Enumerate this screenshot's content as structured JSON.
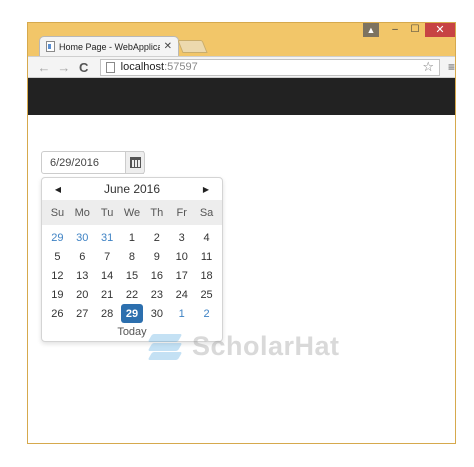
{
  "window": {
    "controls": {
      "user": "▲",
      "minimize": "–",
      "maximize": "☐",
      "close": "✕"
    }
  },
  "tab": {
    "title": "Home Page - WebApplica",
    "close": "✕"
  },
  "toolbar": {
    "back": "←",
    "forward": "→",
    "reload": "C",
    "url_host": "localhost",
    "url_port": ":57597",
    "star": "☆",
    "menu": "≡"
  },
  "date_input": {
    "value": "6/29/2016"
  },
  "datepicker": {
    "prev": "◀",
    "next": "▶",
    "month_label": "June 2016",
    "weekdays": [
      "Su",
      "Mo",
      "Tu",
      "We",
      "Th",
      "Fr",
      "Sa"
    ],
    "days": [
      {
        "d": "29",
        "other": true
      },
      {
        "d": "30",
        "other": true
      },
      {
        "d": "31",
        "other": true
      },
      {
        "d": "1"
      },
      {
        "d": "2"
      },
      {
        "d": "3"
      },
      {
        "d": "4"
      },
      {
        "d": "5"
      },
      {
        "d": "6"
      },
      {
        "d": "7"
      },
      {
        "d": "8"
      },
      {
        "d": "9"
      },
      {
        "d": "10"
      },
      {
        "d": "11"
      },
      {
        "d": "12"
      },
      {
        "d": "13"
      },
      {
        "d": "14"
      },
      {
        "d": "15"
      },
      {
        "d": "16"
      },
      {
        "d": "17"
      },
      {
        "d": "18"
      },
      {
        "d": "19"
      },
      {
        "d": "20"
      },
      {
        "d": "21"
      },
      {
        "d": "22"
      },
      {
        "d": "23"
      },
      {
        "d": "24"
      },
      {
        "d": "25"
      },
      {
        "d": "26"
      },
      {
        "d": "27"
      },
      {
        "d": "28"
      },
      {
        "d": "29",
        "selected": true
      },
      {
        "d": "30"
      },
      {
        "d": "1",
        "other": true
      },
      {
        "d": "2",
        "other": true
      }
    ],
    "today_label": "Today"
  },
  "watermark": {
    "text": "ScholarHat"
  },
  "colors": {
    "frame": "#f2c669",
    "navbar": "#222222",
    "selected_day": "#2c6fae",
    "other_month_day": "#3e82c4"
  }
}
